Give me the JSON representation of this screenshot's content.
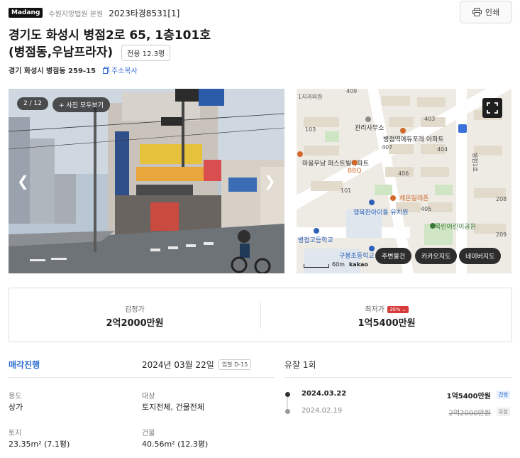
{
  "header": {
    "logo": "Madang",
    "court": "수원지방법원 본원",
    "case_number": "2023타경8531[1]",
    "print_label": "인쇄"
  },
  "property": {
    "title_line1": "경기도 화성시 병점2로 65, 1층101호",
    "title_line2": "(병점동,우남프라자)",
    "area_badge": "전용 12.3평",
    "jibun": "경기 화성시 병점동 259-15",
    "copy_label": "주소복사"
  },
  "photo": {
    "counter": "2 / 12",
    "view_all": "+ 사진 모두보기"
  },
  "map": {
    "labels": [
      "1지과의원",
      "409",
      "관리사무소",
      "병점역에듀포레 아파트",
      "403",
      "405",
      "407",
      "404",
      "103",
      "406",
      "마을우남 퍼스트빌아파트",
      "BBQ",
      "101",
      "체온밀레폰",
      "행복한아이들 유치원",
      "405",
      "병점고등학교",
      "목린어린이공원",
      "구봉초등학교",
      "병점1로",
      "208",
      "209"
    ],
    "scale_label": "60m",
    "kakao": "kakao",
    "buttons": [
      "주변물건",
      "카카오지도",
      "네이버지도"
    ]
  },
  "prices": {
    "appraisal_label": "감정가",
    "appraisal_value": "2억2000만원",
    "minimum_label": "최저가",
    "minimum_pct": "30%",
    "minimum_value": "1억5400만원"
  },
  "auction": {
    "status": "매각진행",
    "sale_date": "2024년 03월 22일",
    "dday": "입찰 D-15",
    "fail_title": "유찰 1회",
    "usage_label": "용도",
    "usage_value": "상가",
    "target_label": "대상",
    "target_value": "토지전체, 건물전체",
    "land_label": "토지",
    "land_value": "23.35m² (7.1평)",
    "building_label": "건물",
    "building_value": "40.56m² (12.3평)",
    "history": [
      {
        "date": "2024.03.22",
        "price": "1억5400만원",
        "badge": "진행"
      },
      {
        "date": "2024.02.19",
        "price": "2억2000만원",
        "badge": "유찰"
      }
    ]
  },
  "colors": {
    "accent_blue": "#2d6ed1",
    "price_red": "#d33333"
  }
}
